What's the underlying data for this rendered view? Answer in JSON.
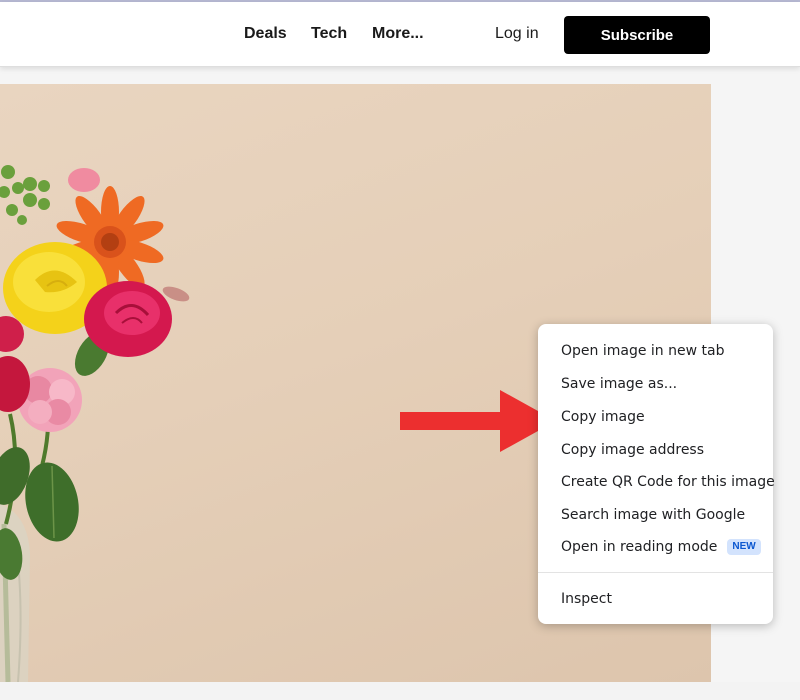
{
  "header": {
    "nav": [
      {
        "label": "Deals"
      },
      {
        "label": "Tech"
      },
      {
        "label": "More..."
      }
    ],
    "login_label": "Log in",
    "subscribe_label": "Subscribe"
  },
  "context_menu": {
    "items": [
      {
        "label": "Open image in new tab"
      },
      {
        "label": "Save image as..."
      },
      {
        "label": "Copy image"
      },
      {
        "label": "Copy image address"
      },
      {
        "label": "Create QR Code for this image"
      },
      {
        "label": "Search image with Google"
      },
      {
        "label": "Open in reading mode",
        "badge": "NEW"
      }
    ],
    "footer_item": {
      "label": "Inspect"
    }
  },
  "annotation": {
    "arrow_color": "#ec2f2f",
    "points_to": "Copy image"
  },
  "colors": {
    "photo_background": "#e6d1bb",
    "subscribe_bg": "#000000",
    "badge_bg": "#d3e3fd",
    "badge_text": "#0b57d0"
  }
}
